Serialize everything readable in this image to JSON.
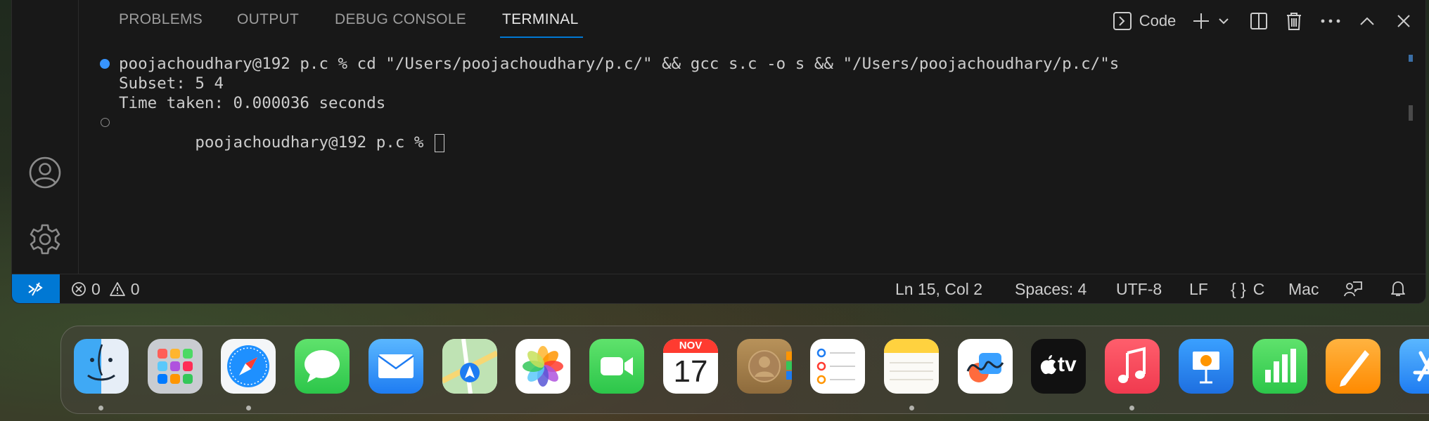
{
  "panel": {
    "tabs": [
      {
        "label": "PROBLEMS"
      },
      {
        "label": "OUTPUT"
      },
      {
        "label": "DEBUG CONSOLE"
      },
      {
        "label": "TERMINAL",
        "active": true
      }
    ],
    "actions": {
      "terminal_name": "Code",
      "icons": [
        "terminal-icon",
        "plus-icon",
        "chevron-down-icon",
        "split-icon",
        "trash-icon",
        "ellipsis-icon",
        "chevron-up-icon",
        "close-icon"
      ]
    }
  },
  "terminal": {
    "lines": [
      "poojachoudhary@192 p.c % cd \"/Users/poojachoudhary/p.c/\" && gcc s.c -o s && \"/Users/poojachoudhary/p.c/\"s",
      "Subset: 5 4",
      "Time taken: 0.000036 seconds",
      "poojachoudhary@192 p.c % "
    ]
  },
  "statusbar": {
    "errors": "0",
    "warnings": "0",
    "position": "Ln 15, Col 2",
    "spaces": "Spaces: 4",
    "encoding": "UTF-8",
    "eol": "LF",
    "language": "C",
    "platform": "Mac"
  },
  "dock": {
    "calendar_month": "NOV",
    "calendar_day": "17",
    "tv_label": "tv",
    "apps": [
      "Finder",
      "Launchpad",
      "Safari",
      "Messages",
      "Mail",
      "Maps",
      "Photos",
      "FaceTime",
      "Calendar",
      "Contacts",
      "Reminders",
      "Notes",
      "Freeform",
      "TV",
      "Music",
      "Keynote",
      "Numbers",
      "Pages",
      "App Store"
    ]
  },
  "colors": {
    "accent": "#0078d4",
    "background": "#181818",
    "text": "#cccccc"
  }
}
